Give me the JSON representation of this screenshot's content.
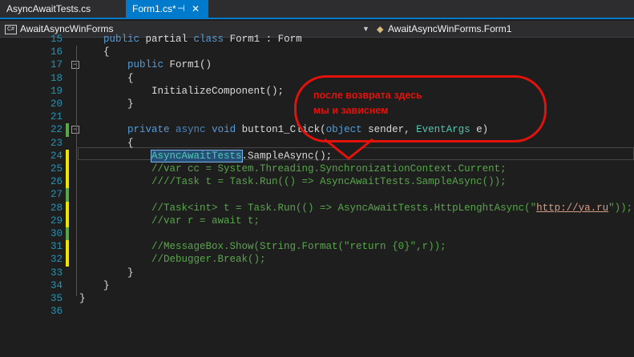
{
  "tabs": [
    {
      "label": "AsyncAwaitTests.cs",
      "active": false
    },
    {
      "label": "Form1.cs*",
      "active": true,
      "pin_icon": "pin-icon",
      "close_icon": "close-icon"
    }
  ],
  "nav": {
    "project": "AwaitAsyncWinForms",
    "project_icon_text": "C#",
    "class": "AwaitAsyncWinForms.Form1"
  },
  "code_lines": [
    {
      "n": "15",
      "parts": [
        [
          "kw",
          "public"
        ],
        [
          "",
          "partial"
        ],
        [
          "kw",
          "class"
        ],
        [
          "",
          "Form1 : Form"
        ]
      ]
    },
    {
      "n": "16",
      "text": "    {"
    },
    {
      "n": "17",
      "text": "        public Form1()"
    },
    {
      "n": "18",
      "text": "        {"
    },
    {
      "n": "19",
      "text": "            InitializeComponent();"
    },
    {
      "n": "20",
      "text": "        }"
    },
    {
      "n": "21",
      "text": ""
    },
    {
      "n": "22",
      "text": "        private async void button1_Click(object sender, EventArgs e)"
    },
    {
      "n": "23",
      "text": "        {"
    },
    {
      "n": "24",
      "text": "            AsyncAwaitTests.SampleAsync();"
    },
    {
      "n": "25",
      "text": "            //var cc = System.Threading.SynchronizationContext.Current;"
    },
    {
      "n": "26",
      "text": "            ////Task t = Task.Run(() => AsyncAwaitTests.SampleAsync());"
    },
    {
      "n": "27",
      "text": ""
    },
    {
      "n": "28",
      "text": "            //Task<int> t = Task.Run(() => AsyncAwaitTests.HttpLenghtAsync(\"http://ya.ru\"));"
    },
    {
      "n": "29",
      "text": "            //var r = await t;"
    },
    {
      "n": "30",
      "text": ""
    },
    {
      "n": "31",
      "text": "            //MessageBox.Show(String.Format(\"return {0}\",r));"
    },
    {
      "n": "32",
      "text": "            //Debugger.Break();"
    },
    {
      "n": "33",
      "text": "        }"
    },
    {
      "n": "34",
      "text": "    }"
    },
    {
      "n": "35",
      "text": "}"
    },
    {
      "n": "36",
      "text": ""
    }
  ],
  "annotation": {
    "line1": "после возврата здесь",
    "line2": "мы и зависнем",
    "color": "#e3120b"
  },
  "colors": {
    "keyword": "#569cd6",
    "type": "#4ec9b0",
    "comment": "#57a64a",
    "string": "#d69d85",
    "line_number": "#2b91af",
    "change_saved": "#57a64a",
    "change_unsaved": "#efe300",
    "tab_active": "#007acc"
  }
}
